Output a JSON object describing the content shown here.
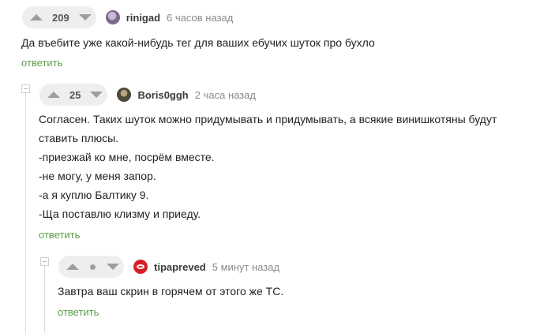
{
  "comments": [
    {
      "votes": "209",
      "author": "rinigad",
      "time": "6 часов назад",
      "lines": [
        "Да въебите уже какой-нибудь тег для ваших ебучих шуток про бухло"
      ],
      "reply_label": "ответить"
    },
    {
      "votes": "25",
      "author": "Boris0ggh",
      "time": "2 часа назад",
      "lines": [
        "Согласен. Таких шуток можно придумывать и придумывать, а всякие винишкотяны будут",
        "ставить плюсы.",
        "-приезжай ко мне, посрём вместе.",
        "-не могу, у меня запор.",
        "-а я куплю Балтику 9.",
        "-Ща поставлю клизму и приеду."
      ],
      "reply_label": "ответить"
    },
    {
      "votes": "",
      "author": "tipapreved",
      "time": "5 минут назад",
      "lines": [
        "Завтра ваш скрин в горячем от этого же ТС."
      ],
      "reply_label": "ответить"
    }
  ],
  "icons": {
    "upvote": "arrow-up-icon",
    "downvote": "arrow-down-icon",
    "collapse": "collapse-minus-icon"
  },
  "colors": {
    "reply": "#5a9e4b",
    "votes_bg": "#eeeeef",
    "arrow": "#9b9ea3",
    "avatar_tipapreved": "#d81f26"
  }
}
